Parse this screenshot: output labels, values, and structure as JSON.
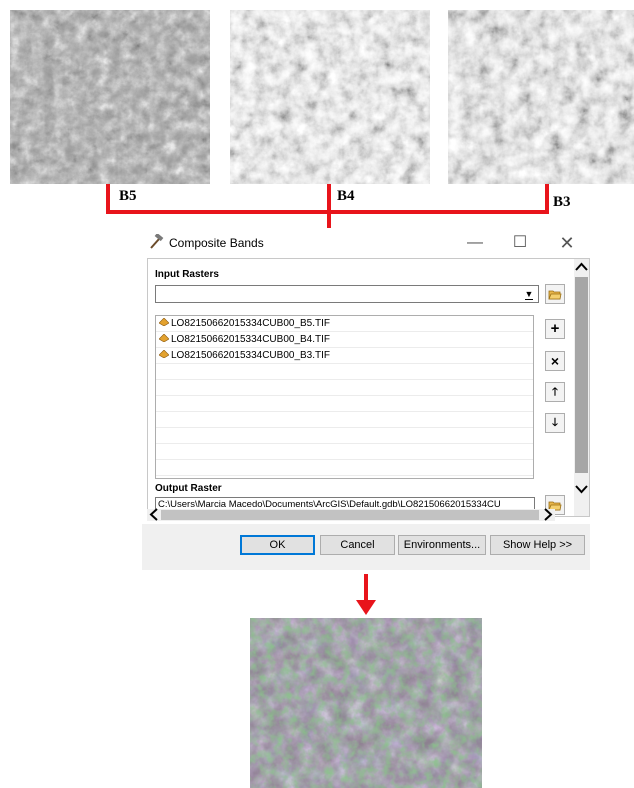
{
  "bands": [
    {
      "label": "B5"
    },
    {
      "label": "B4"
    },
    {
      "label": "B3"
    }
  ],
  "colors": {
    "connector": "#e8141b",
    "accent": "#0078d7"
  },
  "dialog": {
    "title": "Composite Bands",
    "title_icon": "hammer-icon",
    "minimize_glyph": "—",
    "maximize_glyph": "☐",
    "close_glyph": "✕",
    "input_rasters_label": "Input Rasters",
    "input_value": "",
    "rasters": [
      "LO82150662015334CUB00_B5.TIF",
      "LO82150662015334CUB00_B4.TIF",
      "LO82150662015334CUB00_B3.TIF"
    ],
    "empty_rows": 7,
    "side_buttons": {
      "add": "+",
      "delete": "×",
      "up": "🡑",
      "down": "🡓"
    },
    "output_raster_label": "Output Raster",
    "output_value": "C:\\Users\\Marcia Macedo\\Documents\\ArcGIS\\Default.gdb\\LO82150662015334CU",
    "buttons": {
      "ok": "OK",
      "cancel": "Cancel",
      "environments": "Environments...",
      "help": "Show Help >>"
    }
  }
}
